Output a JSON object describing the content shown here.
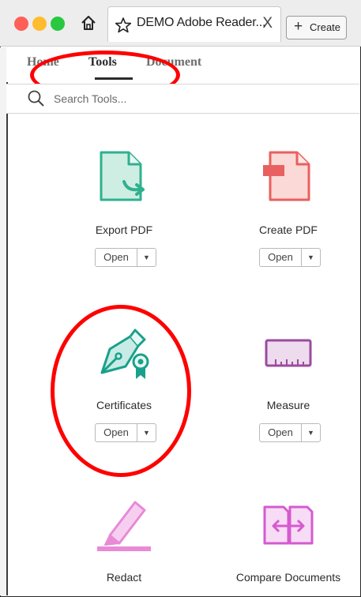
{
  "window": {
    "tab_title": "DEMO Adobe Reader...",
    "tab_close": "X",
    "create_label": "Create"
  },
  "menu": {
    "tabs": [
      {
        "label": "Home"
      },
      {
        "label": "Tools"
      },
      {
        "label": "Document"
      }
    ],
    "active": "Tools"
  },
  "search": {
    "placeholder": "Search Tools..."
  },
  "tools": [
    {
      "name": "Export PDF",
      "open_label": "Open",
      "icon": "export-pdf-icon"
    },
    {
      "name": "Create PDF",
      "open_label": "Open",
      "icon": "create-pdf-icon"
    },
    {
      "name": "Certificates",
      "open_label": "Open",
      "icon": "certificates-icon"
    },
    {
      "name": "Measure",
      "open_label": "Open",
      "icon": "measure-icon"
    },
    {
      "name": "Redact",
      "icon": "redact-icon"
    },
    {
      "name": "Compare Documents",
      "icon": "compare-documents-icon"
    }
  ],
  "colors": {
    "export_teal": "#2fb08f",
    "create_red": "#e8605f",
    "cert_teal": "#1aa08c",
    "measure_purple": "#9b4b9e",
    "redact_pink": "#e88ad6",
    "compare_magenta": "#d65ad0",
    "annotation_red": "#ff0000"
  }
}
